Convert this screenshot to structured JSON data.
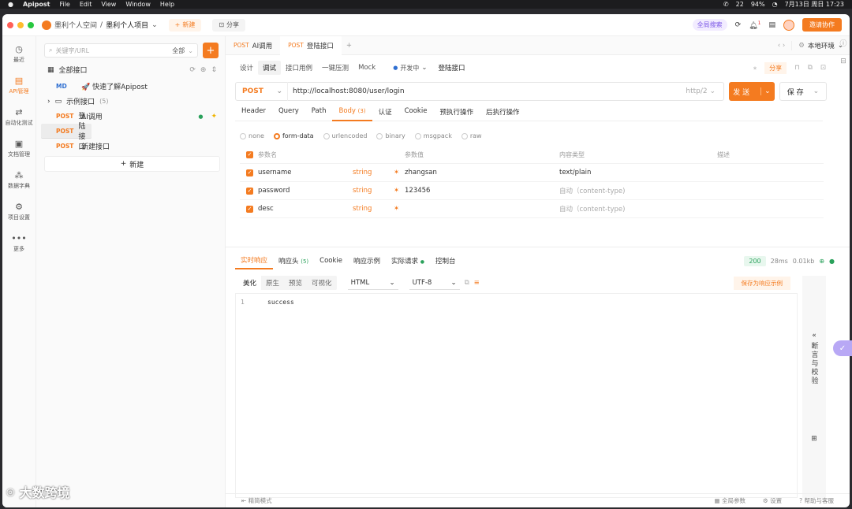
{
  "menubar": {
    "app": "Apipost",
    "items": [
      "File",
      "Edit",
      "View",
      "Window",
      "Help"
    ],
    "battery": "94%",
    "datetime": "7月13日 周日  17:23",
    "wechat_count": "22"
  },
  "titlebar": {
    "workspace": "墨利个人空间",
    "separator": "/",
    "project": "墨利个人项目",
    "new_label": "新建",
    "share_label": "分享",
    "global_search": "全局搜索",
    "notif_count": "1",
    "invite_label": "邀请协作"
  },
  "leftnav": [
    {
      "label": "最近",
      "icon": "clock-icon",
      "glyph": "◷"
    },
    {
      "label": "API管理",
      "icon": "api-icon",
      "glyph": "▤"
    },
    {
      "label": "自动化测试",
      "icon": "flow-icon",
      "glyph": "⇄"
    },
    {
      "label": "文档管理",
      "icon": "doc-icon",
      "glyph": "▣"
    },
    {
      "label": "数据字典",
      "icon": "dict-icon",
      "glyph": "⁂"
    },
    {
      "label": "项目设置",
      "icon": "settings-icon",
      "glyph": "⚙"
    },
    {
      "label": "更多",
      "icon": "more-icon",
      "glyph": "•••"
    }
  ],
  "sidebar": {
    "search_placeholder": "关键字/URL",
    "filter": "全部",
    "tree_root": "全部接口",
    "items": [
      {
        "method": "MD",
        "label": "🚀 快速了解Apipost"
      },
      {
        "method": "",
        "label": "示例接口",
        "count": "(5)"
      },
      {
        "method": "POST",
        "label": "AI调用"
      },
      {
        "method": "POST",
        "label": "登陆接口"
      },
      {
        "method": "POST",
        "label": "新建接口"
      }
    ],
    "new_label": "新建"
  },
  "tabs": [
    {
      "method": "POST",
      "label": "AI调用"
    },
    {
      "method": "POST",
      "label": "登陆接口"
    }
  ],
  "env": "本地环境",
  "subtabs": [
    "设计",
    "调试",
    "接口用例",
    "一键压测",
    "Mock"
  ],
  "status": "开发中",
  "api_name": "登陆接口",
  "share_label": "分享",
  "request": {
    "method": "POST",
    "url": "http://localhost:8080/user/login",
    "protocol": "http/2",
    "send": "发 送",
    "save": "保 存"
  },
  "req_tabs": [
    "Header",
    "Query",
    "Path",
    "Body",
    "认证",
    "Cookie",
    "预执行操作",
    "后执行操作"
  ],
  "body_count": "(3)",
  "body_types": [
    "none",
    "form-data",
    "urlencoded",
    "binary",
    "msgpack",
    "raw"
  ],
  "params": {
    "headers": [
      "参数名",
      "参数值",
      "内容类型",
      "描述"
    ],
    "rows": [
      {
        "name": "username",
        "type": "string",
        "value": "zhangsan",
        "content_type": "text/plain"
      },
      {
        "name": "password",
        "type": "string",
        "value": "123456",
        "content_type": "自动（content-type)"
      },
      {
        "name": "desc",
        "type": "string",
        "value": "",
        "content_type": "自动（content-type)"
      }
    ]
  },
  "response": {
    "tabs": [
      "实时响应",
      "响应头",
      "Cookie",
      "响应示例",
      "实际请求",
      "控制台"
    ],
    "header_count": "(5)",
    "code": "200",
    "time": "28ms",
    "size": "0.01kb",
    "views": [
      "美化",
      "原生",
      "预览",
      "可视化"
    ],
    "format": "HTML",
    "encoding": "UTF-8",
    "save_example": "保存为响应示例",
    "line": "1",
    "body": "success",
    "assert_label": "断言与校验"
  },
  "footer": {
    "mode": "精简模式",
    "global_params": "全局参数",
    "settings": "设置",
    "help": "帮助与客服"
  },
  "watermark": "大数跨境"
}
